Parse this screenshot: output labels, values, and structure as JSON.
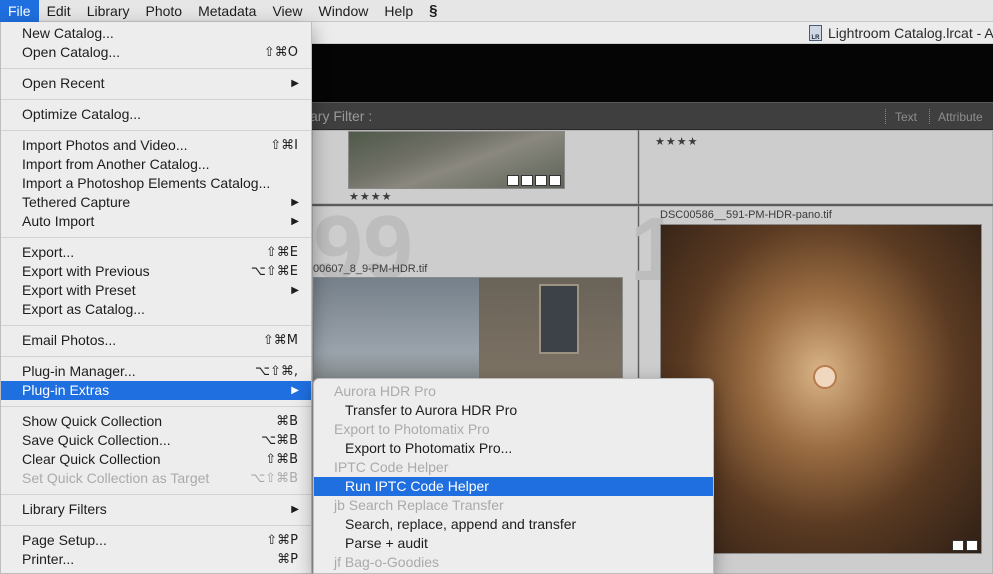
{
  "menubar": {
    "items": [
      {
        "label": "File",
        "active": true
      },
      {
        "label": "Edit"
      },
      {
        "label": "Library"
      },
      {
        "label": "Photo"
      },
      {
        "label": "Metadata"
      },
      {
        "label": "View"
      },
      {
        "label": "Window"
      },
      {
        "label": "Help"
      }
    ],
    "extra_icon": "script-s-icon",
    "extra_glyph": "§"
  },
  "window": {
    "title": "Lightroom Catalog.lrcat - A",
    "catalog_icon_text": "LR"
  },
  "filter_bar": {
    "label": "ary Filter :",
    "tabs": [
      "Text",
      "Attribute"
    ]
  },
  "grid": {
    "cells": [
      {
        "stars": "★★★★",
        "filename": "",
        "number": ""
      },
      {
        "stars": "★★★★",
        "filename": "",
        "number": ""
      },
      {
        "stars": "",
        "filename": "00607_8_9-PM-HDR.tif",
        "number": "99"
      },
      {
        "stars": "",
        "filename": "DSC00586__591-PM-HDR-pano.tif",
        "number": "1"
      }
    ]
  },
  "file_menu": {
    "items": [
      {
        "label": "New Catalog...",
        "shortcut": ""
      },
      {
        "label": "Open Catalog...",
        "shortcut": "⇧⌘O"
      },
      {
        "label": "Open Recent",
        "submenu": true
      },
      {
        "label": "Optimize Catalog...",
        "shortcut": ""
      },
      {
        "label": "Import Photos and Video...",
        "shortcut": "⇧⌘I"
      },
      {
        "label": "Import from Another Catalog...",
        "shortcut": ""
      },
      {
        "label": "Import a Photoshop Elements Catalog...",
        "shortcut": ""
      },
      {
        "label": "Tethered Capture",
        "submenu": true
      },
      {
        "label": "Auto Import",
        "submenu": true
      },
      {
        "label": "Export...",
        "shortcut": "⇧⌘E"
      },
      {
        "label": "Export with Previous",
        "shortcut": "⌥⇧⌘E"
      },
      {
        "label": "Export with Preset",
        "submenu": true
      },
      {
        "label": "Export as Catalog...",
        "shortcut": ""
      },
      {
        "label": "Email Photos...",
        "shortcut": "⇧⌘M"
      },
      {
        "label": "Plug-in Manager...",
        "shortcut": "⌥⇧⌘,"
      },
      {
        "label": "Plug-in Extras",
        "submenu": true,
        "highlighted": true
      },
      {
        "label": "Show Quick Collection",
        "shortcut": "⌘B"
      },
      {
        "label": "Save Quick Collection...",
        "shortcut": "⌥⌘B"
      },
      {
        "label": "Clear Quick Collection",
        "shortcut": "⇧⌘B"
      },
      {
        "label": "Set Quick Collection as Target",
        "shortcut": "⌥⇧⌘B",
        "disabled": true
      },
      {
        "label": "Library Filters",
        "submenu": true
      },
      {
        "label": "Page Setup...",
        "shortcut": "⇧⌘P"
      },
      {
        "label": "Printer...",
        "shortcut": "⌘P"
      }
    ],
    "submenu_arrow": "▶"
  },
  "plugin_extras_menu": {
    "items": [
      {
        "label": "Aurora HDR Pro",
        "header": true
      },
      {
        "label": "Transfer to Aurora HDR Pro"
      },
      {
        "label": "Export to Photomatix Pro",
        "header": true
      },
      {
        "label": "Export to Photomatix Pro..."
      },
      {
        "label": "IPTC Code Helper",
        "header": true
      },
      {
        "label": "Run IPTC Code Helper",
        "highlighted": true
      },
      {
        "label": "jb Search Replace Transfer",
        "header": true
      },
      {
        "label": "Search, replace, append and transfer"
      },
      {
        "label": "Parse + audit"
      },
      {
        "label": "jf Bag-o-Goodies",
        "header": true
      }
    ]
  },
  "colors": {
    "highlight": "#1f6fe0",
    "menu_bg": "#ededed",
    "disabled_text": "#aaaaaa"
  }
}
